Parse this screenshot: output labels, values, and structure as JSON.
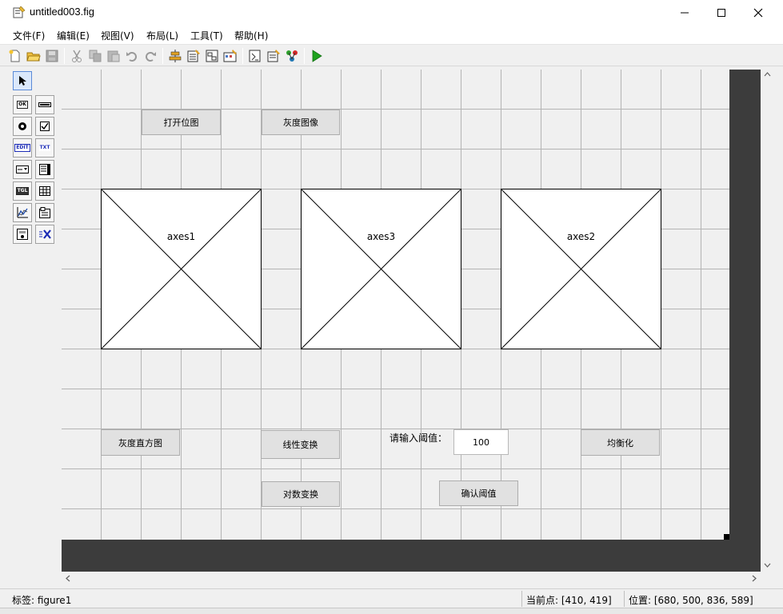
{
  "window": {
    "title": "untitled003.fig"
  },
  "menu": [
    {
      "label": "文件(F)"
    },
    {
      "label": "编辑(E)"
    },
    {
      "label": "视图(V)"
    },
    {
      "label": "布局(L)"
    },
    {
      "label": "工具(T)"
    },
    {
      "label": "帮助(H)"
    }
  ],
  "toolbar": {
    "icons": [
      "new-file-icon",
      "open-folder-icon",
      "save-icon",
      "cut-icon",
      "copy-icon",
      "paste-icon",
      "undo-icon",
      "redo-icon",
      "align-icon",
      "menu-editor-icon",
      "tab-order-icon",
      "toolbar-editor-icon",
      "editor-icon",
      "property-inspector-icon",
      "object-browser-icon",
      "run-icon"
    ]
  },
  "palette": {
    "items": [
      {
        "name": "select-tool",
        "tag": ""
      },
      {
        "name": "push-button-tool",
        "tag": "OK"
      },
      {
        "name": "slider-tool",
        "tag": ""
      },
      {
        "name": "radio-button-tool",
        "tag": ""
      },
      {
        "name": "checkbox-tool",
        "tag": ""
      },
      {
        "name": "edit-text-tool",
        "tag": "EDIT"
      },
      {
        "name": "static-text-tool",
        "tag": "TXT"
      },
      {
        "name": "popup-menu-tool",
        "tag": ""
      },
      {
        "name": "listbox-tool",
        "tag": ""
      },
      {
        "name": "toggle-button-tool",
        "tag": "TGL"
      },
      {
        "name": "table-tool",
        "tag": ""
      },
      {
        "name": "axes-tool",
        "tag": ""
      },
      {
        "name": "panel-tool",
        "tag": ""
      },
      {
        "name": "button-group-tool",
        "tag": ""
      },
      {
        "name": "activex-tool",
        "tag": ""
      }
    ]
  },
  "canvas": {
    "buttons": {
      "open_image": "打开位图",
      "gray_image": "灰度图像",
      "gray_histogram": "灰度直方图",
      "linear_transform": "线性变换",
      "log_transform": "对数变换",
      "confirm_threshold": "确认阈值",
      "equalize": "均衡化"
    },
    "axes": {
      "axes1": "axes1",
      "axes3": "axes3",
      "axes2": "axes2"
    },
    "threshold_label": "请输入阈值：",
    "threshold_value": "100"
  },
  "status": {
    "tag": "标签: figure1",
    "current_point": "当前点: [410, 419]",
    "position": "位置: [680, 500, 836, 589]"
  },
  "colors": {
    "run_green": "#1ea21e",
    "canvas_border": "#3c3c3c",
    "grid_line": "#b4b4b4"
  }
}
